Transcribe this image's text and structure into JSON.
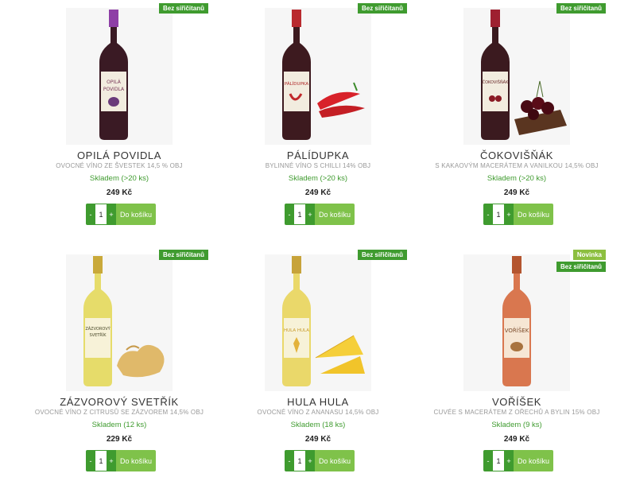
{
  "products": [
    {
      "name": "OPILÁ POVIDLA",
      "description": "OVOCNÉ VÍNO ZE ŠVESTEK 14,5 % OBJ",
      "stock": "Skladem (>20 ks)",
      "price": "249 Kč",
      "badges": [
        "Bez siřičitanů"
      ],
      "label_text": "OPILÁ POVIDLA",
      "bottle_color": "#3a1a24",
      "cap_color": "#8e3fa6",
      "fruit": "plum"
    },
    {
      "name": "PÁLÍDUPKA",
      "description": "BYLINNÉ VÍNO S CHILLI 14% OBJ",
      "stock": "Skladem (>20 ks)",
      "price": "249 Kč",
      "badges": [
        "Bez siřičitanů"
      ],
      "label_text": "PÁLÍDUPKA",
      "bottle_color": "#3d1a1f",
      "cap_color": "#b92a2f",
      "fruit": "chili"
    },
    {
      "name": "ČOKOVIŠŇÁK",
      "description": "S KAKAOVÝM MACERÁTEM A VANILKOU 14,5% OBJ",
      "stock": "Skladem (>20 ks)",
      "price": "249 Kč",
      "badges": [
        "Bez siřičitanů"
      ],
      "label_text": "ČOKOVIŠŇÁK",
      "bottle_color": "#3b1a1f",
      "cap_color": "#9e2030",
      "fruit": "cherry"
    },
    {
      "name": "ZÁZVOROVÝ SVETŘÍK",
      "description": "OVOCNÉ VÍNO Z CITRUSŮ SE ZÁZVOREM 14,5% OBJ",
      "stock": "Skladem (12 ks)",
      "price": "229 Kč",
      "badges": [
        "Bez siřičitanů"
      ],
      "label_text": "ZÁZVOROVÝ SVETŘÍK",
      "bottle_color": "#e6dc6a",
      "cap_color": "#c9a93a",
      "fruit": "ginger"
    },
    {
      "name": "HULA HULA",
      "description": "OVOCNÉ VÍNO Z ANANASU 14,5% OBJ",
      "stock": "Skladem (18 ks)",
      "price": "249 Kč",
      "badges": [
        "Bez siřičitanů"
      ],
      "label_text": "HULA HULA",
      "bottle_color": "#ead86a",
      "cap_color": "#c7a33a",
      "fruit": "pineapple"
    },
    {
      "name": "VOŘÍŠEK",
      "description": "CUVÉE S MACERÁTEM Z OŘECHŮ A BYLIN 15% OBJ",
      "stock": "Skladem (9 ks)",
      "price": "249 Kč",
      "badges": [
        "Novinka",
        "Bez siřičitanů"
      ],
      "label_text": "VOŘÍŠEK",
      "bottle_color": "#d9774f",
      "cap_color": "#b4552f",
      "fruit": "walnut"
    }
  ],
  "cart": {
    "qty": "1",
    "minus": "-",
    "plus": "+",
    "add_label": "Do košíku"
  },
  "colors": {
    "badge_green": "#3f9b2f",
    "badge_new": "#8cbf3f",
    "stock_green": "#3f9b2f",
    "cart_button": "#7fc24a"
  }
}
